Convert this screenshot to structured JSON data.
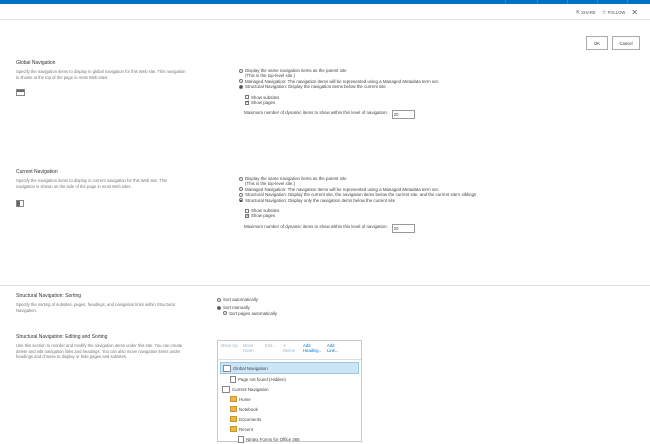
{
  "topbar": {
    "share": "SHARE",
    "follow": "FOLLOW"
  },
  "buttons": {
    "ok": "OK",
    "cancel": "Cancel"
  },
  "global_nav": {
    "title": "Global Navigation",
    "desc1": "Specify the navigation items to display in global navigation for this Web site. This navigation",
    "desc2": "is shown at the top of the page in most Web sites.",
    "opt1": "Display the same navigation items as the parent site",
    "opt1b": "(This is the top-level site.)",
    "opt2": "Managed Navigation: The navigation items will be represented using a Managed Metadata term set.",
    "opt3": "Structural Navigation: Display the navigation items below the current site",
    "show_subsites": "Show subsites",
    "show_pages": "Show pages",
    "max_label": "Maximum number of dynamic items to show within this level of navigation:",
    "max_value": "20"
  },
  "current_nav": {
    "title": "Current Navigation",
    "desc1": "Specify the navigation items to display in current navigation for this Web site. This",
    "desc2": "navigation is shown on the side of the page in most Web sites.",
    "opt1": "Display the same navigation items as the parent site",
    "opt1b": "(This is the top-level site.)",
    "opt2": "Managed Navigation: The navigation items will be represented using a Managed Metadata term set.",
    "opt3": "Structural Navigation: Display the current site, the navigation items below the current site, and the current site's siblings",
    "opt4": "Structural Navigation: Display only the navigation items below the current site",
    "show_subsites": "Show subsites",
    "show_pages": "Show pages",
    "max_label": "Maximum number of dynamic items to show within this level of navigation:",
    "max_value": "20"
  },
  "sorting": {
    "title": "Structural Navigation: Sorting",
    "desc1": "Specify the sorting of subsites, pages, headings, and navigation links within Structural",
    "desc2": "Navigation.",
    "opt_auto": "Sort automatically",
    "opt_manual": "Sort manually",
    "opt_pages_auto": "Sort pages automatically"
  },
  "editing": {
    "title": "Structural Navigation: Editing and Sorting",
    "desc1": "Use this section to reorder and modify the navigation items under this site. You can create,",
    "desc2": "delete and edit navigation links and headings. You can also move navigation items under",
    "desc3": "headings and choose to display or hide pages and subsites.",
    "toolbar": {
      "move_up": "Move Up",
      "move_down": "Move Down",
      "edit": "Edit...",
      "delete": "Delete",
      "add_heading": "Add Heading...",
      "add_link": "Add Link..."
    },
    "tree": {
      "global_nav": "Global Navigation",
      "page_not_found": "Page not found (Hidden)",
      "current_nav": "Current Navigation",
      "home": "Home",
      "notebook": "Notebook",
      "documents": "Documents",
      "recent": "Recent",
      "recent_child": "Nintex Forms for Office 365"
    }
  }
}
